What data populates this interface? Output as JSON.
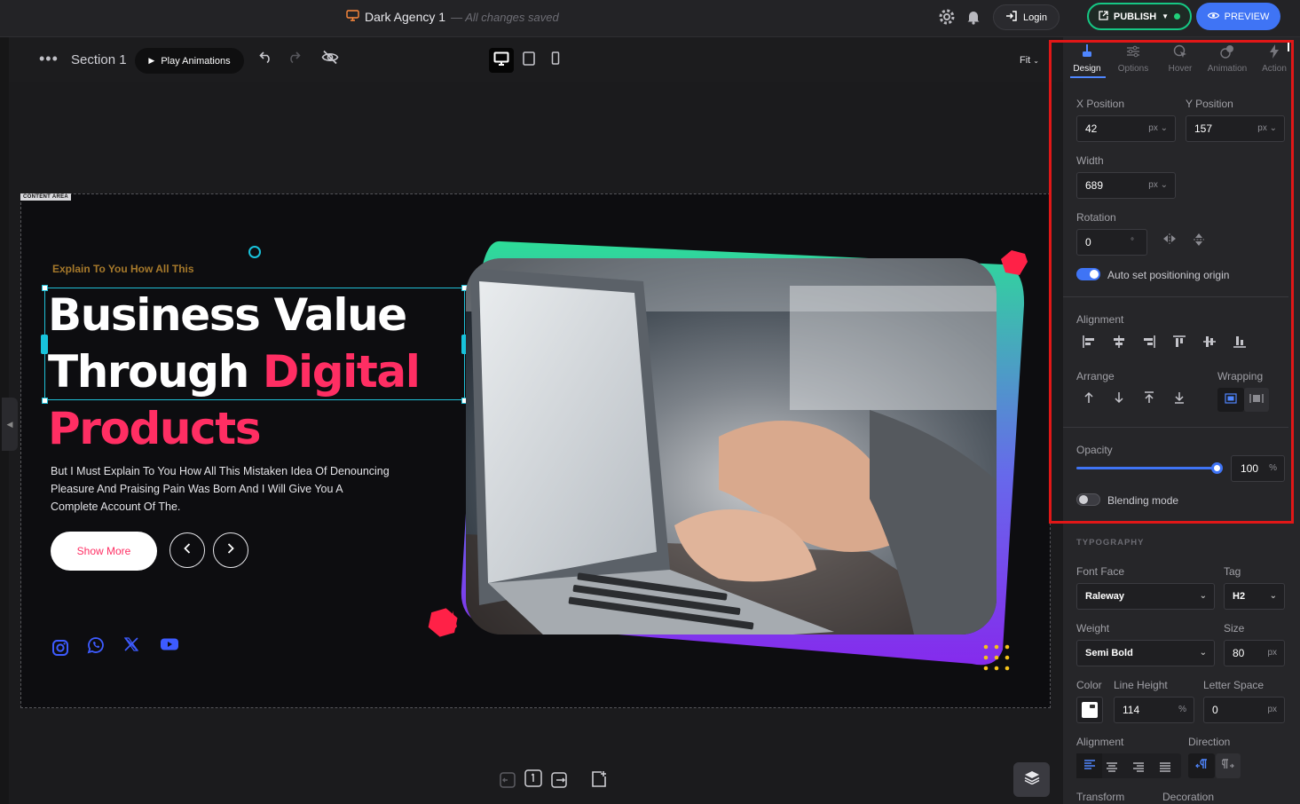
{
  "topbar": {
    "doc_title": "Dark Agency 1",
    "saved_status": "— All changes saved",
    "login_label": "Login",
    "publish_label": "PUBLISH",
    "preview_label": "PREVIEW"
  },
  "toolbar": {
    "section_label": "Section 1",
    "play_label": "Play Animations",
    "fit_label": "Fit"
  },
  "canvas": {
    "content_area_label": "CONTENT AREA",
    "eyebrow": "Explain To You How All This",
    "headline": {
      "line1": "Business Value",
      "line2_white": "Through",
      "line2_pink": "Digital",
      "line3": "Products"
    },
    "body_line1": "But I Must Explain To You How All This Mistaken Idea Of Denouncing",
    "body_line2": "Pleasure And Praising Pain Was Born And I Will Give You A",
    "body_line3": "Complete Account Of The.",
    "cta_label": "Show More",
    "colors": {
      "accent": "#ff2e63",
      "selection": "#1fbfd6",
      "eyebrow": "#a6792b"
    }
  },
  "panel": {
    "tabs": [
      {
        "label": "Design",
        "icon": "brush-icon"
      },
      {
        "label": "Options",
        "icon": "sliders-icon"
      },
      {
        "label": "Hover",
        "icon": "cursor-icon"
      },
      {
        "label": "Animation",
        "icon": "animation-icon"
      },
      {
        "label": "Action",
        "icon": "bolt-icon"
      }
    ],
    "x_label": "X Position",
    "x_value": "42",
    "x_unit": "px",
    "y_label": "Y Position",
    "y_value": "157",
    "y_unit": "px",
    "width_label": "Width",
    "width_value": "689",
    "width_unit": "px",
    "rotation_label": "Rotation",
    "rotation_value": "0",
    "rotation_unit": "°",
    "auto_origin_label": "Auto set positioning origin",
    "alignment_label": "Alignment",
    "arrange_label": "Arrange",
    "wrapping_label": "Wrapping",
    "opacity_label": "Opacity",
    "opacity_value": "100",
    "opacity_unit": "%",
    "opacity_fraction": 1.0,
    "blending_label": "Blending mode",
    "typography_title": "TYPOGRAPHY",
    "font_face_label": "Font Face",
    "font_face_value": "Raleway",
    "tag_label": "Tag",
    "tag_value": "H2",
    "weight_label": "Weight",
    "weight_value": "Semi Bold",
    "size_label": "Size",
    "size_value": "80",
    "size_unit": "px",
    "color_label": "Color",
    "line_height_label": "Line Height",
    "line_height_value": "114",
    "line_height_unit": "%",
    "letter_space_label": "Letter Space",
    "letter_space_value": "0",
    "letter_space_unit": "px",
    "text_alignment_label": "Alignment",
    "direction_label": "Direction",
    "transform_label": "Transform",
    "decoration_label": "Decoration"
  }
}
